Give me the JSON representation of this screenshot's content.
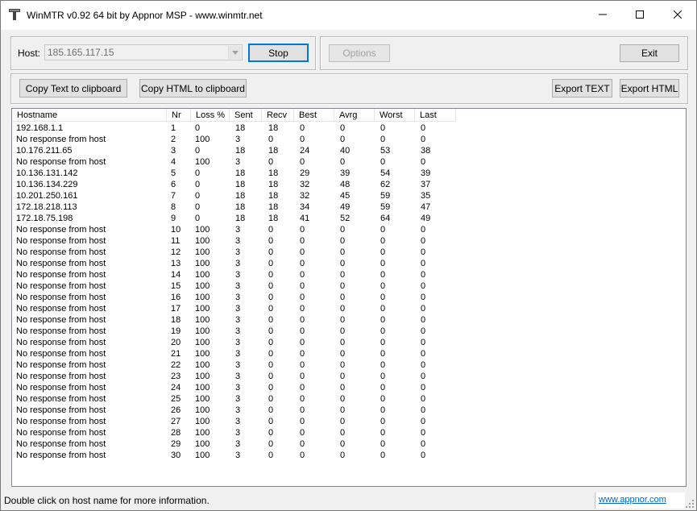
{
  "window": {
    "title": "WinMTR v0.92 64 bit by Appnor MSP - www.winmtr.net"
  },
  "controls": {
    "host_label": "Host:",
    "host_value": "185.165.117.15",
    "stop_label": "Stop",
    "options_label": "Options",
    "exit_label": "Exit",
    "copy_text_label": "Copy Text to clipboard",
    "copy_html_label": "Copy HTML to clipboard",
    "export_text_label": "Export TEXT",
    "export_html_label": "Export HTML"
  },
  "table": {
    "columns": [
      "Hostname",
      "Nr",
      "Loss %",
      "Sent",
      "Recv",
      "Best",
      "Avrg",
      "Worst",
      "Last"
    ],
    "rows": [
      [
        "192.168.1.1",
        "1",
        "0",
        "18",
        "18",
        "0",
        "0",
        "0",
        "0"
      ],
      [
        "No response from host",
        "2",
        "100",
        "3",
        "0",
        "0",
        "0",
        "0",
        "0"
      ],
      [
        "10.176.211.65",
        "3",
        "0",
        "18",
        "18",
        "24",
        "40",
        "53",
        "38"
      ],
      [
        "No response from host",
        "4",
        "100",
        "3",
        "0",
        "0",
        "0",
        "0",
        "0"
      ],
      [
        "10.136.131.142",
        "5",
        "0",
        "18",
        "18",
        "29",
        "39",
        "54",
        "39"
      ],
      [
        "10.136.134.229",
        "6",
        "0",
        "18",
        "18",
        "32",
        "48",
        "62",
        "37"
      ],
      [
        "10.201.250.161",
        "7",
        "0",
        "18",
        "18",
        "32",
        "45",
        "59",
        "35"
      ],
      [
        "172.18.218.113",
        "8",
        "0",
        "18",
        "18",
        "34",
        "49",
        "59",
        "47"
      ],
      [
        "172.18.75.198",
        "9",
        "0",
        "18",
        "18",
        "41",
        "52",
        "64",
        "49"
      ],
      [
        "No response from host",
        "10",
        "100",
        "3",
        "0",
        "0",
        "0",
        "0",
        "0"
      ],
      [
        "No response from host",
        "11",
        "100",
        "3",
        "0",
        "0",
        "0",
        "0",
        "0"
      ],
      [
        "No response from host",
        "12",
        "100",
        "3",
        "0",
        "0",
        "0",
        "0",
        "0"
      ],
      [
        "No response from host",
        "13",
        "100",
        "3",
        "0",
        "0",
        "0",
        "0",
        "0"
      ],
      [
        "No response from host",
        "14",
        "100",
        "3",
        "0",
        "0",
        "0",
        "0",
        "0"
      ],
      [
        "No response from host",
        "15",
        "100",
        "3",
        "0",
        "0",
        "0",
        "0",
        "0"
      ],
      [
        "No response from host",
        "16",
        "100",
        "3",
        "0",
        "0",
        "0",
        "0",
        "0"
      ],
      [
        "No response from host",
        "17",
        "100",
        "3",
        "0",
        "0",
        "0",
        "0",
        "0"
      ],
      [
        "No response from host",
        "18",
        "100",
        "3",
        "0",
        "0",
        "0",
        "0",
        "0"
      ],
      [
        "No response from host",
        "19",
        "100",
        "3",
        "0",
        "0",
        "0",
        "0",
        "0"
      ],
      [
        "No response from host",
        "20",
        "100",
        "3",
        "0",
        "0",
        "0",
        "0",
        "0"
      ],
      [
        "No response from host",
        "21",
        "100",
        "3",
        "0",
        "0",
        "0",
        "0",
        "0"
      ],
      [
        "No response from host",
        "22",
        "100",
        "3",
        "0",
        "0",
        "0",
        "0",
        "0"
      ],
      [
        "No response from host",
        "23",
        "100",
        "3",
        "0",
        "0",
        "0",
        "0",
        "0"
      ],
      [
        "No response from host",
        "24",
        "100",
        "3",
        "0",
        "0",
        "0",
        "0",
        "0"
      ],
      [
        "No response from host",
        "25",
        "100",
        "3",
        "0",
        "0",
        "0",
        "0",
        "0"
      ],
      [
        "No response from host",
        "26",
        "100",
        "3",
        "0",
        "0",
        "0",
        "0",
        "0"
      ],
      [
        "No response from host",
        "27",
        "100",
        "3",
        "0",
        "0",
        "0",
        "0",
        "0"
      ],
      [
        "No response from host",
        "28",
        "100",
        "3",
        "0",
        "0",
        "0",
        "0",
        "0"
      ],
      [
        "No response from host",
        "29",
        "100",
        "3",
        "0",
        "0",
        "0",
        "0",
        "0"
      ],
      [
        "No response from host",
        "30",
        "100",
        "3",
        "0",
        "0",
        "0",
        "0",
        "0"
      ]
    ]
  },
  "status": {
    "text": "Double click on host name for more information.",
    "link": "www.appnor.com"
  },
  "icons": {
    "app": "winmtr-app-icon",
    "minimize": "minimize-icon",
    "maximize": "maximize-icon",
    "close": "close-icon",
    "dropdown": "chevron-down-icon",
    "grip": "resize-grip-icon"
  },
  "colors": {
    "link": "#0066cc",
    "default_button_border": "#0078d7"
  }
}
